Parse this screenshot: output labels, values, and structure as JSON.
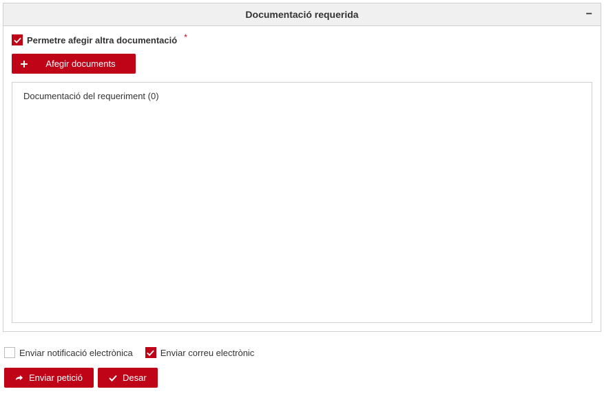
{
  "panel": {
    "title": "Documentació requerida",
    "collapse_symbol": "−"
  },
  "allow_extra_docs": {
    "label": "Permetre afegir altra documentació",
    "required_mark": "*",
    "checked": true
  },
  "add_docs_button": {
    "label": "Afegir documents"
  },
  "documents_area": {
    "label": "Documentació del requeriment (0)"
  },
  "send_notification": {
    "label": "Enviar notificació electrònica",
    "checked": false
  },
  "send_email": {
    "label": "Enviar correu electrònic",
    "checked": true
  },
  "actions": {
    "send_request": "Enviar petició",
    "save": "Desar"
  }
}
